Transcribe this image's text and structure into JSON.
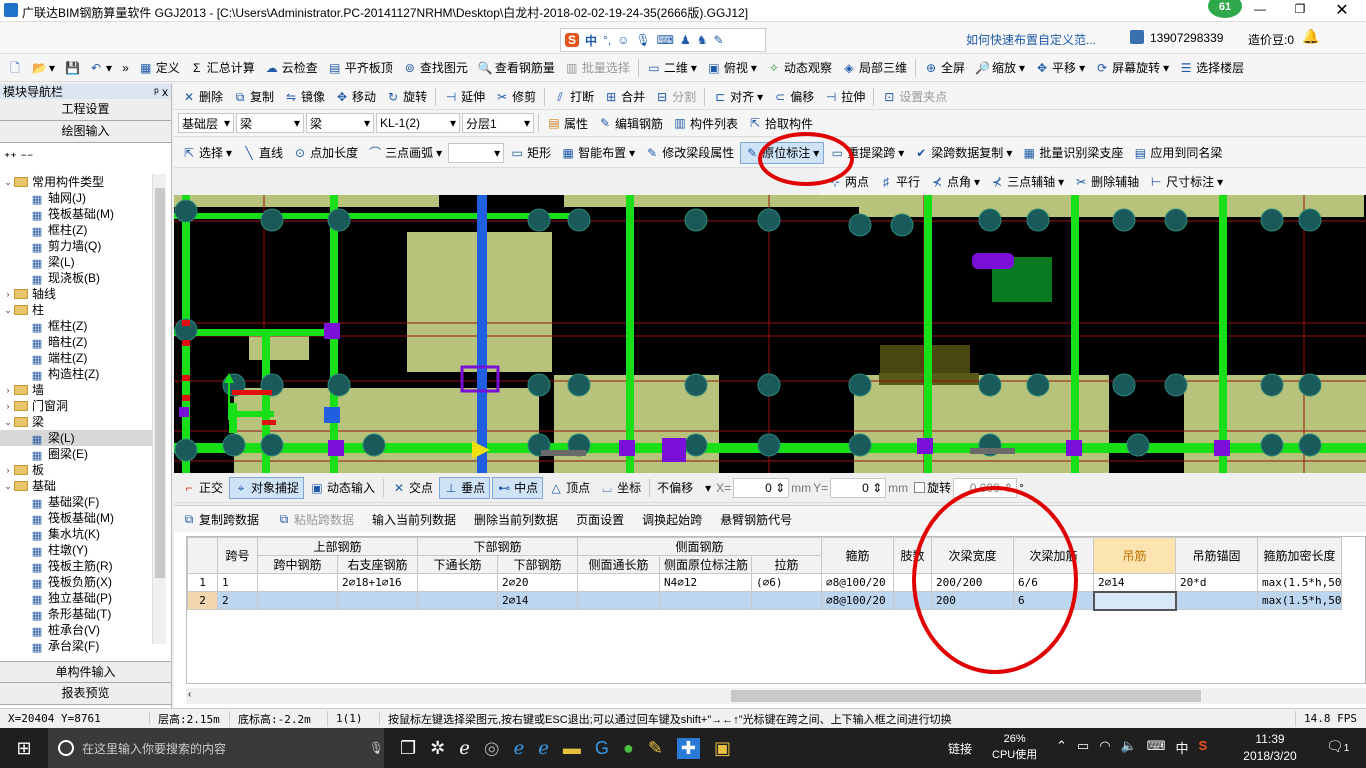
{
  "window": {
    "title": "广联达BIM钢筋算量软件 GGJ2013 - [C:\\Users\\Administrator.PC-20141127NRHM\\Desktop\\白龙村-2018-02-02-19-24-35(2666版).GGJ12]",
    "badge": "61"
  },
  "topbar": {
    "help_link": "如何快速布置自定义范...",
    "phone": "13907298339",
    "price": "造价豆:0",
    "ime": "中"
  },
  "toolbar1": [
    "定义",
    "汇总计算",
    "云检查",
    "平齐板顶",
    "查找图元",
    "查看钢筋量",
    "批量选择",
    "二维",
    "俯视",
    "动态观察",
    "局部三维",
    "全屏",
    "缩放",
    "平移",
    "屏幕旋转",
    "选择楼层"
  ],
  "toolbar2": [
    "删除",
    "复制",
    "镜像",
    "移动",
    "旋转",
    "延伸",
    "修剪",
    "打断",
    "合并",
    "分割",
    "对齐",
    "偏移",
    "拉伸",
    "设置夹点"
  ],
  "toolbar3": {
    "selects": [
      "基础层",
      "梁",
      "梁",
      "KL-1(2)",
      "分层1"
    ],
    "buttons": [
      "属性",
      "编辑钢筋",
      "构件列表",
      "拾取构件"
    ]
  },
  "toolbar4": [
    "选择",
    "直线",
    "点加长度",
    "三点画弧",
    "矩形",
    "智能布置",
    "修改梁段属性",
    "原位标注",
    "重提梁跨",
    "梁跨数据复制",
    "批量识别梁支座",
    "应用到同名梁"
  ],
  "toolbar5": [
    "两点",
    "平行",
    "点角",
    "三点辅轴",
    "删除辅轴",
    "尺寸标注"
  ],
  "nav": {
    "header": "模块导航栏",
    "pin": "ᵖ x",
    "top_buttons": [
      "工程设置",
      "绘图输入"
    ],
    "bottom_buttons": [
      "单构件输入",
      "报表预览"
    ],
    "tree": [
      {
        "level": 0,
        "type": "folder",
        "label": "常用构件类型",
        "open": true
      },
      {
        "level": 1,
        "type": "leaf",
        "label": "轴网(J)"
      },
      {
        "level": 1,
        "type": "leaf",
        "label": "筏板基础(M)"
      },
      {
        "level": 1,
        "type": "leaf",
        "label": "框柱(Z)"
      },
      {
        "level": 1,
        "type": "leaf",
        "label": "剪力墙(Q)"
      },
      {
        "level": 1,
        "type": "leaf",
        "label": "梁(L)"
      },
      {
        "level": 1,
        "type": "leaf",
        "label": "现浇板(B)"
      },
      {
        "level": 0,
        "type": "folder",
        "label": "轴线",
        "open": false
      },
      {
        "level": 0,
        "type": "folder",
        "label": "柱",
        "open": true
      },
      {
        "level": 1,
        "type": "leaf",
        "label": "框柱(Z)"
      },
      {
        "level": 1,
        "type": "leaf",
        "label": "暗柱(Z)"
      },
      {
        "level": 1,
        "type": "leaf",
        "label": "端柱(Z)"
      },
      {
        "level": 1,
        "type": "leaf",
        "label": "构造柱(Z)"
      },
      {
        "level": 0,
        "type": "folder",
        "label": "墙",
        "open": false
      },
      {
        "level": 0,
        "type": "folder",
        "label": "门窗洞",
        "open": false
      },
      {
        "level": 0,
        "type": "folder",
        "label": "梁",
        "open": true
      },
      {
        "level": 1,
        "type": "leaf",
        "label": "梁(L)",
        "selected": true
      },
      {
        "level": 1,
        "type": "leaf",
        "label": "圈梁(E)"
      },
      {
        "level": 0,
        "type": "folder",
        "label": "板",
        "open": false
      },
      {
        "level": 0,
        "type": "folder",
        "label": "基础",
        "open": true
      },
      {
        "level": 1,
        "type": "leaf",
        "label": "基础梁(F)"
      },
      {
        "level": 1,
        "type": "leaf",
        "label": "筏板基础(M)"
      },
      {
        "level": 1,
        "type": "leaf",
        "label": "集水坑(K)"
      },
      {
        "level": 1,
        "type": "leaf",
        "label": "柱墩(Y)"
      },
      {
        "level": 1,
        "type": "leaf",
        "label": "筏板主筋(R)"
      },
      {
        "level": 1,
        "type": "leaf",
        "label": "筏板负筋(X)"
      },
      {
        "level": 1,
        "type": "leaf",
        "label": "独立基础(P)"
      },
      {
        "level": 1,
        "type": "leaf",
        "label": "条形基础(T)"
      },
      {
        "level": 1,
        "type": "leaf",
        "label": "桩承台(V)"
      },
      {
        "level": 1,
        "type": "leaf",
        "label": "承台梁(F)"
      }
    ]
  },
  "snapbar": {
    "buttons": [
      "正交",
      "对象捕捉",
      "动态输入",
      "交点",
      "垂点",
      "中点",
      "顶点",
      "坐标"
    ],
    "offset_select": "不偏移",
    "x_label": "X=",
    "x_value": "0",
    "x_unit": "mm",
    "y_label": "Y=",
    "y_value": "0",
    "y_unit": "mm",
    "rotate_label": "旋转",
    "rotate_value": "0.000",
    "rotate_unit": "°"
  },
  "gridbar": [
    "复制跨数据",
    "粘贴跨数据",
    "输入当前列数据",
    "删除当前列数据",
    "页面设置",
    "调换起始跨",
    "悬臂钢筋代号"
  ],
  "table": {
    "group_headers": [
      {
        "label": "",
        "span": 1
      },
      {
        "label": "跨号",
        "span": 1
      },
      {
        "label": "上部钢筋",
        "span": 2
      },
      {
        "label": "下部钢筋",
        "span": 2
      },
      {
        "label": "侧面钢筋",
        "span": 3
      },
      {
        "label": "箍筋",
        "span": 1
      },
      {
        "label": "肢数",
        "span": 1
      },
      {
        "label": "次梁宽度",
        "span": 1
      },
      {
        "label": "次梁加筋",
        "span": 1
      },
      {
        "label": "吊筋",
        "span": 1
      },
      {
        "label": "吊筋锚固",
        "span": 1
      },
      {
        "label": "箍筋加密长度",
        "span": 1
      }
    ],
    "sub_headers": [
      "跨中钢筋",
      "右支座钢筋",
      "下通长筋",
      "下部钢筋",
      "侧面通长筋",
      "侧面原位标注筋",
      "拉筋"
    ],
    "rows": [
      [
        "1",
        "1",
        "",
        "2⌀18+1⌀16",
        "",
        "2⌀20",
        "",
        "N4⌀12",
        "(⌀6)",
        "⌀8@100/20",
        "",
        "200/200",
        "6/6",
        "2⌀14",
        "20*d",
        "max(1.5*h,50"
      ],
      [
        "2",
        "2",
        "",
        "",
        "",
        "2⌀14",
        "",
        "",
        "",
        "⌀8@100/20",
        "",
        "200",
        "6",
        "",
        "",
        "max(1.5*h,50"
      ]
    ]
  },
  "status": {
    "coords": "X=20404 Y=8761",
    "floor_height": "层高:2.15m",
    "base_height": "底标高:-2.2m",
    "count": "1(1)",
    "hint": "按鼠标左键选择梁图元,按右键或ESC退出;可以通过回车键及shift+\"→←↑\"光标键在跨之间、上下输入框之间进行切换",
    "fps": "14.8 FPS"
  },
  "taskbar": {
    "search_placeholder": "在这里输入你要搜索的内容",
    "cpu_percent": "26%",
    "cpu_label": "CPU使用",
    "link": "链接",
    "ime": "中",
    "time": "11:39",
    "date": "2018/3/20",
    "notifications": "1"
  }
}
